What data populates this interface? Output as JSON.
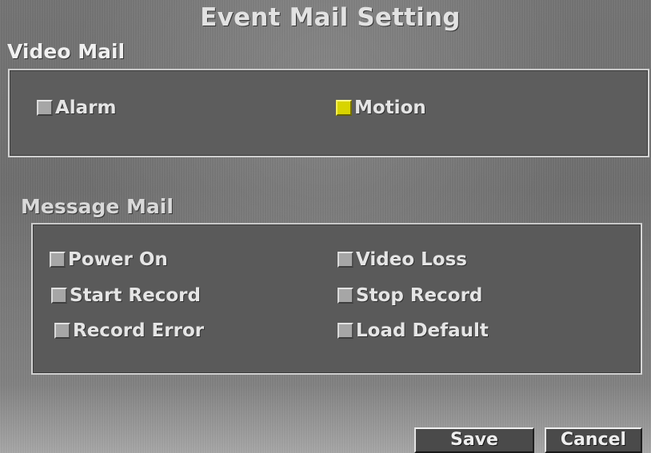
{
  "header": {
    "title": "Event Mail Setting"
  },
  "video_mail": {
    "title": "Video Mail",
    "items": [
      {
        "label": "Alarm",
        "checked": false
      },
      {
        "label": "Motion",
        "checked": true
      }
    ]
  },
  "message_mail": {
    "title": "Message Mail",
    "items": [
      {
        "label": "Power On",
        "checked": false
      },
      {
        "label": "Video Loss",
        "checked": false
      },
      {
        "label": "Start Record",
        "checked": false
      },
      {
        "label": "Stop Record",
        "checked": false
      },
      {
        "label": "Record Error",
        "checked": false
      },
      {
        "label": "Load Default",
        "checked": false
      }
    ]
  },
  "actions": {
    "save_label": "Save",
    "cancel_label": "Cancel"
  },
  "colors": {
    "screen_background": "#747474",
    "panel_background": "#5d5d5d",
    "checkbox_checked": "#d8d400",
    "checkbox_unchecked": "#a6a6a6",
    "text": "#e5e5e5"
  }
}
